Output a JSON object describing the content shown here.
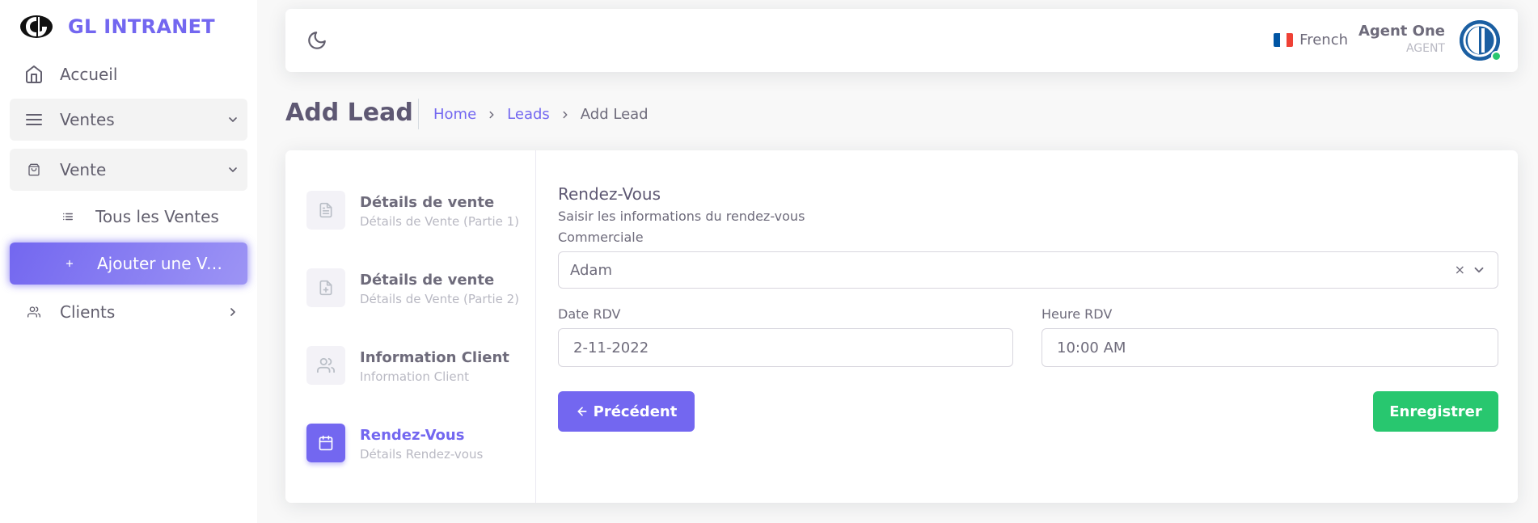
{
  "brand": {
    "name": "GL INTRANET"
  },
  "sidebar": {
    "items": [
      {
        "label": "Accueil",
        "icon": "home-icon"
      },
      {
        "label": "Ventes",
        "icon": "menu-icon"
      },
      {
        "label": "Vente",
        "icon": "shopping-bag-icon"
      },
      {
        "label": "Clients",
        "icon": "users-icon"
      }
    ],
    "subitems": [
      {
        "label": "Tous les Ventes",
        "icon": "list-icon"
      },
      {
        "label": "Ajouter une Ve...",
        "icon": "plus-icon"
      }
    ]
  },
  "navbar": {
    "language": "French",
    "user_name": "Agent One",
    "user_role": "AGENT"
  },
  "header": {
    "title": "Add Lead",
    "breadcrumb": [
      "Home",
      "Leads",
      "Add Lead"
    ]
  },
  "steps": [
    {
      "title": "Détails de vente",
      "subtitle": "Détails de Vente (Partie 1)",
      "icon": "file-text-icon"
    },
    {
      "title": "Détails de vente",
      "subtitle": "Détails de Vente (Partie 2)",
      "icon": "file-plus-icon"
    },
    {
      "title": "Information Client",
      "subtitle": "Information Client",
      "icon": "users-icon"
    },
    {
      "title": "Rendez-Vous",
      "subtitle": "Détails Rendez-vous",
      "icon": "calendar-icon"
    }
  ],
  "form": {
    "title": "Rendez-Vous",
    "subtitle": "Saisir les informations du rendez-vous",
    "commercial_label": "Commerciale",
    "commercial_value": "Adam",
    "clear_symbol": "×",
    "date_label": "Date RDV",
    "date_value": "2-11-2022",
    "time_label": "Heure RDV",
    "time_value": "10:00 AM",
    "prev_label": "Précédent",
    "save_label": "Enregistrer"
  },
  "colors": {
    "primary": "#7367f0",
    "success": "#28c76f",
    "text": "#6e6b7b"
  }
}
